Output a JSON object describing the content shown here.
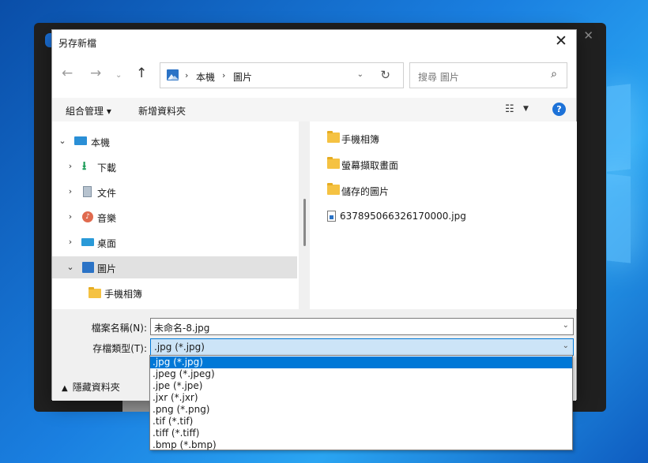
{
  "dialog": {
    "title": "另存新檔",
    "close": "✕"
  },
  "nav": {
    "back": "←",
    "forward": "→",
    "recent": "⌄",
    "up": "↑",
    "breadcrumb": [
      "本機",
      "圖片"
    ],
    "search_placeholder": "搜尋 圖片"
  },
  "toolbar": {
    "organize": "組合管理 ▾",
    "new_folder": "新增資料夾",
    "help": "?"
  },
  "tree": [
    {
      "label": "本機",
      "chev": "⌄",
      "icon": "pc-icon",
      "indent": 0
    },
    {
      "label": "下載",
      "chev": "›",
      "icon": "download-icon",
      "indent": 1
    },
    {
      "label": "文件",
      "chev": "›",
      "icon": "document-icon",
      "indent": 1
    },
    {
      "label": "音樂",
      "chev": "›",
      "icon": "music-icon",
      "indent": 1
    },
    {
      "label": "桌面",
      "chev": "›",
      "icon": "desktop-icon",
      "indent": 1
    },
    {
      "label": "圖片",
      "chev": "⌄",
      "icon": "pictures-icon",
      "indent": 1,
      "selected": true
    },
    {
      "label": "手機相簿",
      "chev": "",
      "icon": "folder-icon",
      "indent": 2
    }
  ],
  "files": [
    {
      "label": "手機相簿",
      "icon": "folder-icon"
    },
    {
      "label": "螢幕擷取畫面",
      "icon": "folder-icon"
    },
    {
      "label": "儲存的圖片",
      "icon": "folder-icon"
    },
    {
      "label": "637895066326170000.jpg",
      "icon": "image-file-icon"
    }
  ],
  "form": {
    "filename_label": "檔案名稱(N):",
    "filename_value": "未命名-8.jpg",
    "filetype_label": "存檔類型(T):",
    "filetype_value": ".jpg (*.jpg)",
    "hide_folders": "隱藏資料夾"
  },
  "filetype_options": [
    ".jpg (*.jpg)",
    ".jpeg (*.jpeg)",
    ".jpe (*.jpe)",
    ".jxr (*.jxr)",
    ".png (*.png)",
    ".tif (*.tif)",
    ".tiff (*.tiff)",
    ".bmp (*.bmp)"
  ],
  "filetype_selected_index": 0
}
